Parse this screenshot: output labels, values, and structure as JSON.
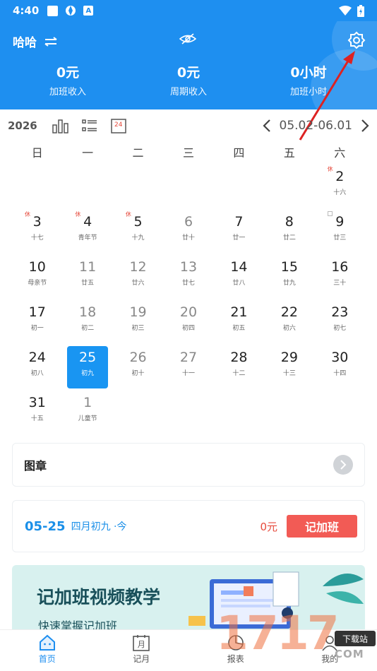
{
  "status": {
    "time": "4:40",
    "app_badge": "A"
  },
  "header": {
    "user_name": "哈哈",
    "stats": [
      {
        "value": "0元",
        "label": "加班收入"
      },
      {
        "value": "0元",
        "label": "周期收入"
      },
      {
        "value": "0小时",
        "label": "加班小时"
      }
    ]
  },
  "toolbar": {
    "year": "2026",
    "calendar_icon_day": "24",
    "range": "05.02-06.01"
  },
  "weekdays": [
    "日",
    "一",
    "二",
    "三",
    "四",
    "五",
    "六"
  ],
  "days": [
    {
      "num": "",
      "lunar": ""
    },
    {
      "num": "",
      "lunar": ""
    },
    {
      "num": "",
      "lunar": ""
    },
    {
      "num": "",
      "lunar": ""
    },
    {
      "num": "",
      "lunar": ""
    },
    {
      "num": "",
      "lunar": ""
    },
    {
      "num": "2",
      "lunar": "十六",
      "tag": "休"
    },
    {
      "num": "3",
      "lunar": "十七",
      "tag": "休"
    },
    {
      "num": "4",
      "lunar": "青年节",
      "tag": "休"
    },
    {
      "num": "5",
      "lunar": "十九",
      "tag": "休"
    },
    {
      "num": "6",
      "lunar": "廿十",
      "gray": true
    },
    {
      "num": "7",
      "lunar": "廿一"
    },
    {
      "num": "8",
      "lunar": "廿二"
    },
    {
      "num": "9",
      "lunar": "廿三",
      "ban": true
    },
    {
      "num": "10",
      "lunar": "母亲节"
    },
    {
      "num": "11",
      "lunar": "廿五",
      "gray": true
    },
    {
      "num": "12",
      "lunar": "廿六",
      "gray": true
    },
    {
      "num": "13",
      "lunar": "廿七",
      "gray": true
    },
    {
      "num": "14",
      "lunar": "廿八"
    },
    {
      "num": "15",
      "lunar": "廿九"
    },
    {
      "num": "16",
      "lunar": "三十"
    },
    {
      "num": "17",
      "lunar": "初一"
    },
    {
      "num": "18",
      "lunar": "初二",
      "gray": true
    },
    {
      "num": "19",
      "lunar": "初三",
      "gray": true
    },
    {
      "num": "20",
      "lunar": "初四",
      "gray": true
    },
    {
      "num": "21",
      "lunar": "初五"
    },
    {
      "num": "22",
      "lunar": "初六"
    },
    {
      "num": "23",
      "lunar": "初七"
    },
    {
      "num": "24",
      "lunar": "初八"
    },
    {
      "num": "25",
      "lunar": "初九",
      "selected": true
    },
    {
      "num": "26",
      "lunar": "初十",
      "gray": true
    },
    {
      "num": "27",
      "lunar": "十一",
      "gray": true
    },
    {
      "num": "28",
      "lunar": "十二"
    },
    {
      "num": "29",
      "lunar": "十三"
    },
    {
      "num": "30",
      "lunar": "十四"
    },
    {
      "num": "31",
      "lunar": "十五"
    },
    {
      "num": "1",
      "lunar": "儿童节",
      "gray": true
    }
  ],
  "stamp_card": {
    "title": "图章"
  },
  "record_card": {
    "date": "05-25",
    "lunar": "四月初九 ·今",
    "amount": "0元",
    "button": "记加班"
  },
  "banner": {
    "title": "记加班视频教学",
    "subtitle": "快速掌握记加班"
  },
  "bottom_nav": [
    {
      "label": "首页",
      "icon": "home-icon"
    },
    {
      "label": "记月",
      "icon": "month-calendar-icon",
      "glyph": "月"
    },
    {
      "label": "报表",
      "icon": "report-icon"
    },
    {
      "label": "我的",
      "icon": "profile-icon"
    }
  ],
  "watermark": {
    "text": "1717",
    "badge": "下载站",
    "domain": "COM"
  },
  "colors": {
    "primary": "#1e8ff0",
    "accent_red": "#f25b55",
    "holiday_tag": "#e64a3c"
  }
}
